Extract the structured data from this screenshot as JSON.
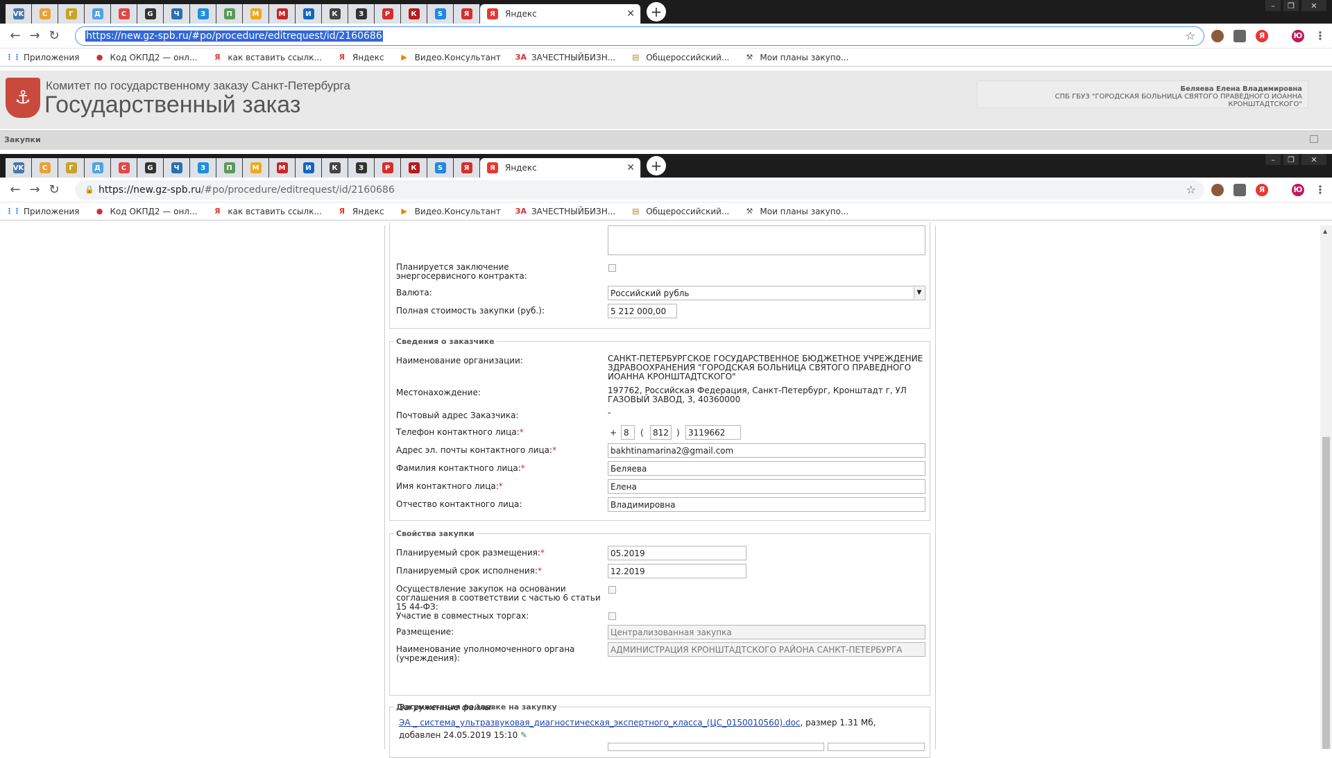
{
  "browser": {
    "active_tab_title": "Яндекс",
    "new_tab": "+",
    "tabs_favicons": [
      "VK",
      "С",
      "Г",
      "Д",
      "С",
      "G",
      "Ч",
      "З",
      "П",
      "М",
      "M",
      "И",
      "К",
      "З",
      "Р",
      "К",
      "S",
      "Я"
    ],
    "url_selected": "https://new.gz-spb.ru/#po/procedure/editrequest/id/2160686",
    "url_host": "https://new.gz-spb.ru",
    "url_path": "/#po/procedure/editrequest/id/2160686",
    "bookmarks": [
      {
        "label": "Приложения",
        "icon": "apps-grid-icon"
      },
      {
        "label": "Код ОКПД2 — онл...",
        "icon": "red-circle-icon"
      },
      {
        "label": "как вставить ссылк...",
        "icon": "yandex-icon"
      },
      {
        "label": "Яндекс",
        "icon": "yandex-icon"
      },
      {
        "label": "Видео.Консультант",
        "icon": "consultant-icon"
      },
      {
        "label": "ЗАЧЕСТНЫЙБИЗН...",
        "icon": "za-icon"
      },
      {
        "label": "Общероссийский...",
        "icon": "doc-icon"
      },
      {
        "label": "Мои планы закупо...",
        "icon": "hammer-icon"
      }
    ],
    "profile_letter": "Ю"
  },
  "site": {
    "title_small": "Комитет по государственному заказу Санкт-Петербурга",
    "title_large": "Государственный заказ",
    "user_name": "Беляева Елена Владимировна",
    "user_org": "СПБ ГБУЗ \"ГОРОДСКАЯ БОЛЬНИЦА СВЯТОГО ПРАВЕДНОГО ИОАННА КРОНШТАДТСКОГО\"",
    "menu_label": "Закупки"
  },
  "form": {
    "energy_contract_label": "Планируется заключение энергосервисного контракта:",
    "currency_label": "Валюта:",
    "currency_value": "Российский рубль",
    "total_label": "Полная стоимость закупки (руб.):",
    "total_value": "5 212 000,00",
    "customer": {
      "legend": "Сведения о заказчике",
      "org_label": "Наименование организации:",
      "org_value": "САНКТ-ПЕТЕРБУРГСКОЕ ГОСУДАРСТВЕННОЕ БЮДЖЕТНОЕ УЧРЕЖДЕНИЕ ЗДРАВООХРАНЕНИЯ \"ГОРОДСКАЯ БОЛЬНИЦА СВЯТОГО ПРАВЕДНОГО ИОАННА КРОНШТАДТСКОГО\"",
      "location_label": "Местонахождение:",
      "location_value": "197762, Российская Федерация, Санкт-Петербург, Кронштадт г, УЛ ГАЗОВЫЙ ЗАВОД, 3, 40360000",
      "postal_label": "Почтовый адрес Заказчика:",
      "postal_value": "-",
      "phone_label": "Телефон контактного лица:",
      "phone_plus": "+",
      "phone_country": "8",
      "phone_open": "(",
      "phone_code": "812",
      "phone_close": ")",
      "phone_number": "3119662",
      "email_label": "Адрес эл. почты контактного лица:",
      "email_value": "bakhtinamarina2@gmail.com",
      "surname_label": "Фамилия контактного лица:",
      "surname_value": "Беляева",
      "name_label": "Имя контактного лица:",
      "name_value": "Елена",
      "patronymic_label": "Отчество контактного лица:",
      "patronymic_value": "Владимировна",
      "required_mark": "*"
    },
    "props": {
      "legend": "Свойства закупки",
      "placement_date_label": "Планируемый срок размещения:",
      "placement_date_value": "05.2019",
      "exec_date_label": "Планируемый срок исполнения:",
      "exec_date_value": "12.2019",
      "agreement_label": "Осуществление закупок на основании соглашения в соответствии с частью 6 статьи 15 44-ФЗ:",
      "joint_label": "Участие в совместных торгах:",
      "placement_label": "Размещение:",
      "placement_value": "Централизованная закупка",
      "authority_label": "Наименование уполномоченного органа (учреждения):",
      "authority_value": "АДМИНИСТРАЦИЯ КРОНШТАДТСКОГО РАЙОНА САНКТ-ПЕТЕРБУРГА"
    },
    "docs": {
      "legend": "Документация по заявке на закупку",
      "uploaded_label": "Загруженные файлы",
      "file_name": "ЭА _ система_ультразвуковая_диагностическая_экспертного_класса_(ЦС_0150010560).doc",
      "file_meta": ", размер 1.31 Мб, добавлен 24.05.2019",
      "file_time": "15:10"
    }
  }
}
